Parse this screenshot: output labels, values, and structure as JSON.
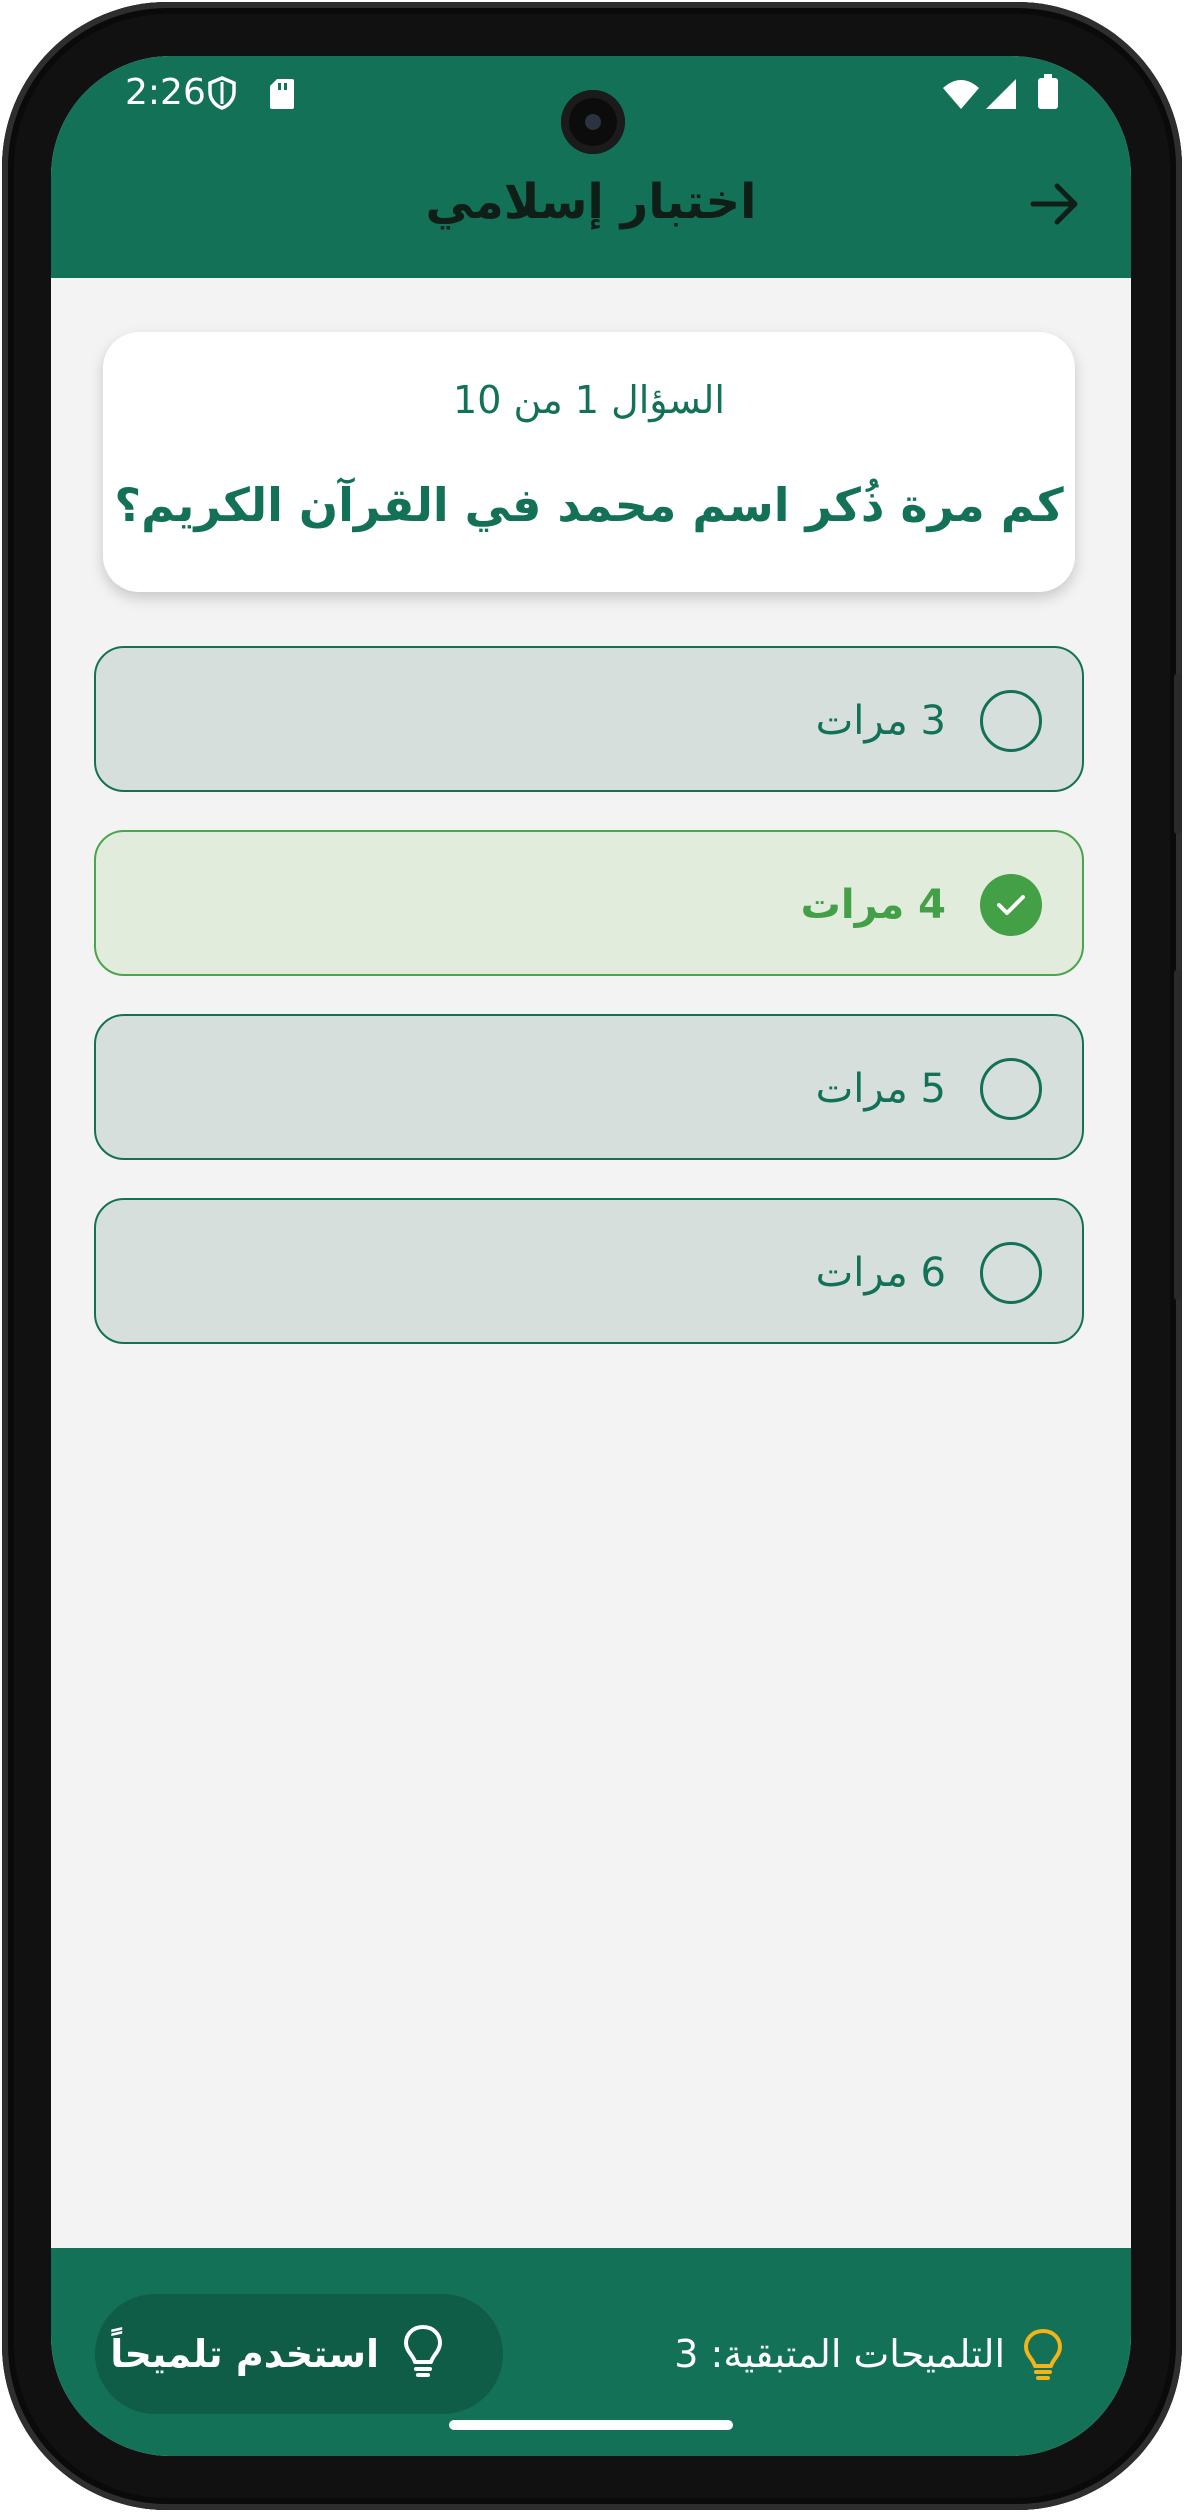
{
  "status_bar": {
    "time": "2:26",
    "left_icons": [
      "shield-icon",
      "sd-card-icon"
    ],
    "right_icons": [
      "wifi-icon",
      "signal-icon",
      "battery-icon"
    ]
  },
  "app_bar": {
    "title": "اختبار إسلامي",
    "back_icon": "arrow-right-icon"
  },
  "question": {
    "counter": "السؤال 1 من 10",
    "text": "كم مرة ذُكر اسم محمد في القرآن الكريم؟"
  },
  "options": [
    {
      "label": "3 مرات",
      "selected": false
    },
    {
      "label": "4 مرات",
      "selected": true
    },
    {
      "label": "5 مرات",
      "selected": false
    },
    {
      "label": "6 مرات",
      "selected": false
    }
  ],
  "bottom_bar": {
    "hints_remaining": "التلميحات المتبقية: 3",
    "use_hint_button": "استخدم تلميحاً",
    "hint_icon": "lightbulb-icon"
  },
  "colors": {
    "primary": "#137157",
    "primary_dark": "#0f5c47",
    "selected_green": "#43a047",
    "option_bg": "#d6dfdc",
    "selected_bg": "#e1ecdc",
    "screen_bg": "#f3f3f3",
    "hint_accent": "#f5b316"
  }
}
